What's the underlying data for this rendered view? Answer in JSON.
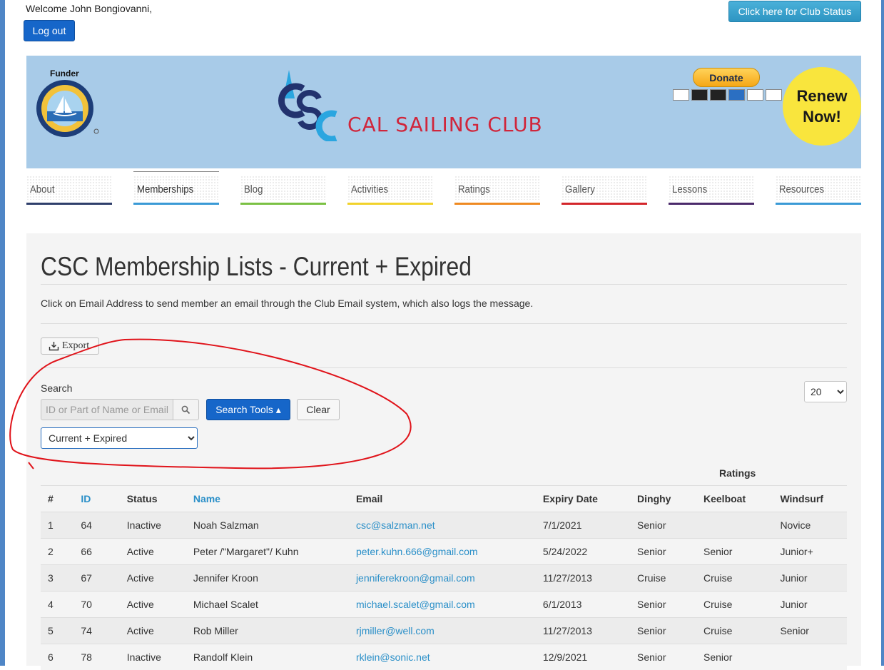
{
  "header": {
    "welcome": "Welcome John Bongiovanni,",
    "logout_label": "Log out",
    "club_status_label": "Click here for Club Status"
  },
  "banner": {
    "funder_label": "Funder",
    "club_name": "CAL SAILING CLUB",
    "donate_label": "Donate",
    "renew_line1": "Renew",
    "renew_line2": "Now!"
  },
  "nav": {
    "items": [
      {
        "label": "About",
        "color": "#2f3f6b"
      },
      {
        "label": "Memberships",
        "color": "#3a9ad6"
      },
      {
        "label": "Blog",
        "color": "#7bc144"
      },
      {
        "label": "Activities",
        "color": "#f1d22b"
      },
      {
        "label": "Ratings",
        "color": "#ef8a22"
      },
      {
        "label": "Gallery",
        "color": "#d3262b"
      },
      {
        "label": "Lessons",
        "color": "#4b2a6b"
      },
      {
        "label": "Resources",
        "color": "#3a9ad6"
      }
    ],
    "active": "Memberships"
  },
  "main": {
    "title": "CSC Membership Lists - Current + Expired",
    "intro": "Click on Email Address to send member an email through the Club Email system, which also logs the message.",
    "export_label": "Export",
    "search_label": "Search",
    "search_placeholder": "ID or Part of Name or Email",
    "search_tools_label": "Search Tools",
    "clear_label": "Clear",
    "status_filter": "Current + Expired",
    "page_size": "20",
    "ratings_header": "Ratings"
  },
  "table": {
    "columns": [
      "#",
      "ID",
      "Status",
      "Name",
      "Email",
      "Expiry Date",
      "Dinghy",
      "Keelboat",
      "Windsurf"
    ],
    "rows": [
      [
        "1",
        "64",
        "Inactive",
        "Noah Salzman",
        "csc@salzman.net",
        "7/1/2021",
        "Senior",
        "",
        "Novice"
      ],
      [
        "2",
        "66",
        "Active",
        "Peter /\"Margaret\"/ Kuhn",
        "peter.kuhn.666@gmail.com",
        "5/24/2022",
        "Senior",
        "Senior",
        "Junior+"
      ],
      [
        "3",
        "67",
        "Active",
        "Jennifer Kroon",
        "jenniferekroon@gmail.com",
        "11/27/2013",
        "Cruise",
        "Cruise",
        "Junior"
      ],
      [
        "4",
        "70",
        "Active",
        "Michael Scalet",
        "michael.scalet@gmail.com",
        "6/1/2013",
        "Senior",
        "Cruise",
        "Junior"
      ],
      [
        "5",
        "74",
        "Active",
        "Rob Miller",
        "rjmiller@well.com",
        "11/27/2013",
        "Senior",
        "Cruise",
        "Senior"
      ],
      [
        "6",
        "78",
        "Inactive",
        "Randolf Klein",
        "rklein@sonic.net",
        "12/9/2021",
        "Senior",
        "Senior",
        ""
      ]
    ]
  },
  "colors": {
    "primary_button": "#1666c9",
    "link": "#2a8fc8",
    "annotation": "#e0131a"
  }
}
